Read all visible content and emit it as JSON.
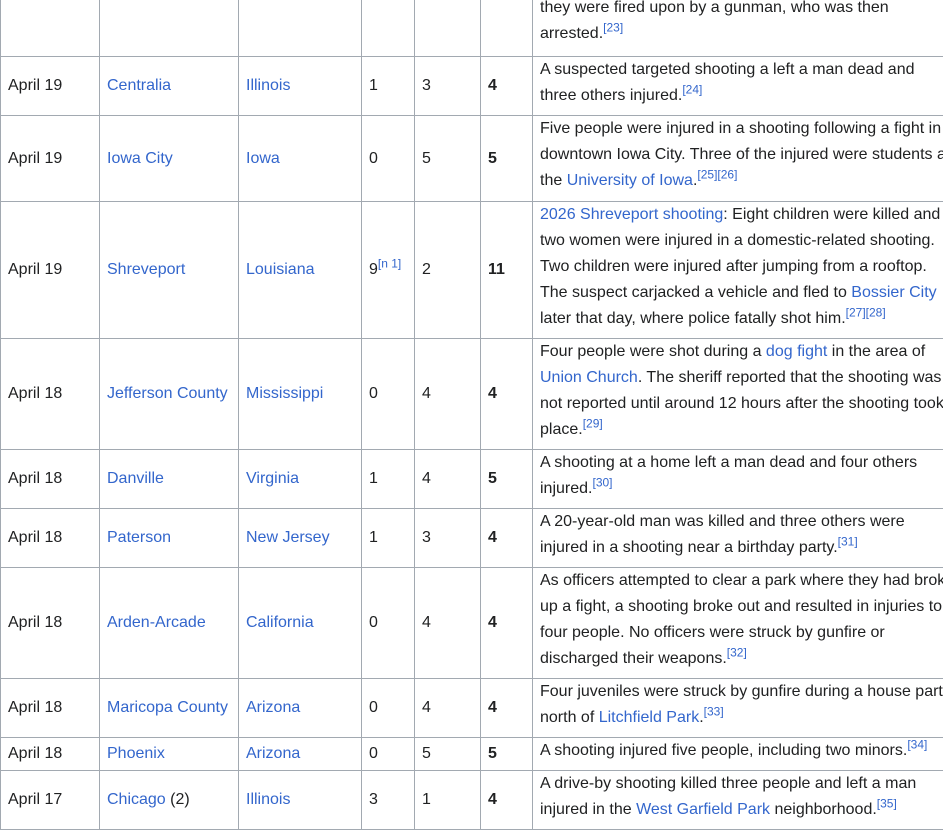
{
  "rows": [
    {
      "date": "",
      "city": "",
      "city_note": "",
      "state": "",
      "dead": "",
      "dead_note": "",
      "injured": "",
      "total": "",
      "desc": [
        {
          "t": "they were fired upon by a gunman, who was then arrested."
        },
        {
          "ref": "[23]"
        }
      ]
    },
    {
      "date": "April 19",
      "city": "Centralia",
      "city_note": "",
      "state": "Illinois",
      "dead": "1",
      "dead_note": "",
      "injured": "3",
      "total": "4",
      "desc": [
        {
          "t": "A suspected targeted shooting a left a man dead and three others injured."
        },
        {
          "ref": "[24]"
        }
      ]
    },
    {
      "date": "April 19",
      "city": "Iowa City",
      "city_note": "",
      "state": "Iowa",
      "dead": "0",
      "dead_note": "",
      "injured": "5",
      "total": "5",
      "desc": [
        {
          "t": "Five people were injured in a shooting following a fight in downtown Iowa City. Three of the injured were students at the "
        },
        {
          "link": "University of Iowa"
        },
        {
          "t": "."
        },
        {
          "ref": "[25][26]"
        }
      ]
    },
    {
      "date": "April 19",
      "city": "Shreveport",
      "city_note": "",
      "state": "Louisiana",
      "dead": "9",
      "dead_note": "[n 1]",
      "injured": "2",
      "total": "11",
      "desc": [
        {
          "link": "2026 Shreveport shooting"
        },
        {
          "t": ": Eight children were killed and two women were injured in a domestic-related shooting. Two children were injured after jumping from a rooftop. The suspect carjacked a vehicle and fled to "
        },
        {
          "link": "Bossier City"
        },
        {
          "t": " later that day, where police fatally shot him."
        },
        {
          "ref": "[27][28]"
        }
      ]
    },
    {
      "date": "April 18",
      "city": "Jefferson County",
      "city_note": "",
      "state": "Mississippi",
      "dead": "0",
      "dead_note": "",
      "injured": "4",
      "total": "4",
      "desc": [
        {
          "t": "Four people were shot during a "
        },
        {
          "link": "dog fight"
        },
        {
          "t": " in the area of "
        },
        {
          "link": "Union Church"
        },
        {
          "t": ". The sheriff reported that the shooting was not reported until around 12 hours after the shooting took place."
        },
        {
          "ref": "[29]"
        }
      ]
    },
    {
      "date": "April 18",
      "city": "Danville",
      "city_note": "",
      "state": "Virginia",
      "dead": "1",
      "dead_note": "",
      "injured": "4",
      "total": "5",
      "desc": [
        {
          "t": "A shooting at a home left a man dead and four others injured."
        },
        {
          "ref": "[30]"
        }
      ]
    },
    {
      "date": "April 18",
      "city": "Paterson",
      "city_note": "",
      "state": "New Jersey",
      "dead": "1",
      "dead_note": "",
      "injured": "3",
      "total": "4",
      "desc": [
        {
          "t": "A 20-year-old man was killed and three others were injured in a shooting near a birthday party."
        },
        {
          "ref": "[31]"
        }
      ]
    },
    {
      "date": "April 18",
      "city": "Arden-Arcade",
      "city_note": "",
      "state": "California",
      "dead": "0",
      "dead_note": "",
      "injured": "4",
      "total": "4",
      "desc": [
        {
          "t": "As officers attempted to clear a park where they had broke up a fight, a shooting broke out and resulted in injuries to four people. No officers were struck by gunfire or discharged their weapons."
        },
        {
          "ref": "[32]"
        }
      ]
    },
    {
      "date": "April 18",
      "city": "Maricopa County",
      "city_note": "",
      "state": "Arizona",
      "dead": "0",
      "dead_note": "",
      "injured": "4",
      "total": "4",
      "desc": [
        {
          "t": "Four juveniles were struck by gunfire during a house party north of "
        },
        {
          "link": "Litchfield Park"
        },
        {
          "t": "."
        },
        {
          "ref": "[33]"
        }
      ]
    },
    {
      "date": "April 18",
      "city": "Phoenix",
      "city_note": "",
      "state": "Arizona",
      "dead": "0",
      "dead_note": "",
      "injured": "5",
      "total": "5",
      "desc": [
        {
          "t": "A shooting injured five people, including two minors."
        },
        {
          "ref": "[34]"
        }
      ]
    },
    {
      "date": "April 17",
      "city": "Chicago",
      "city_note": " (2)",
      "state": "Illinois",
      "dead": "3",
      "dead_note": "",
      "injured": "1",
      "total": "4",
      "desc": [
        {
          "t": "A drive-by shooting killed three people and left a man injured in the "
        },
        {
          "link": "West Garfield Park"
        },
        {
          "t": " neighborhood."
        },
        {
          "ref": "[35]"
        }
      ]
    }
  ],
  "colors": {
    "link": "#3366cc",
    "border": "#a2a9b1",
    "text": "#202122"
  }
}
